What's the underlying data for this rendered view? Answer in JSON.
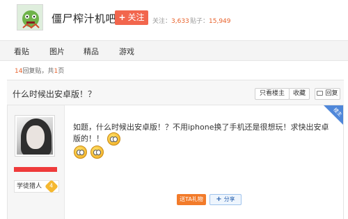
{
  "header": {
    "forum_name": "僵尸榨汁机吧",
    "follow_label": "关注",
    "follow_icon": "plus-icon",
    "followers_label": "关注：",
    "followers_count": "3,633",
    "posts_label": "贴子：",
    "posts_count": "15,949"
  },
  "tabs": [
    "看贴",
    "图片",
    "精品",
    "游戏"
  ],
  "thread": {
    "reply_count": "14",
    "reply_text": "回复贴，共",
    "page_count": "1",
    "page_suffix": "页",
    "title": "什么时候出安卓版！？",
    "actions": {
      "only_op": "只看楼主",
      "favorite": "收藏",
      "reply": "回复"
    }
  },
  "post": {
    "author_name": "学徒猎人",
    "author_level": "4",
    "badge": "楼主",
    "content": "如题，什么时候出安卓版！？不用iphone换了手机还是很想玩！求快出安卓版的！！",
    "gift_label": "送TA礼物",
    "share_label": "分享"
  },
  "colors": {
    "accent": "#f2664d",
    "count_orange": "#e8622c",
    "badge_blue": "#4f87d9"
  }
}
